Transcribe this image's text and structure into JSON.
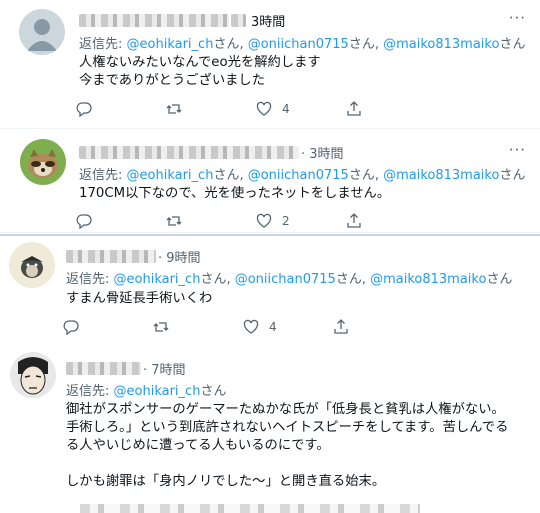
{
  "tweets": [
    {
      "time": "3時間",
      "reply_prefix": "返信先: ",
      "mentions": [
        "@eohikari_ch",
        "@oniichan0715",
        "@maiko813maiko"
      ],
      "san": "さん",
      "sep": ", ",
      "lines": [
        "人権ないみたいなんでeo光を解約します",
        "今までありがとうございました"
      ],
      "counts": {
        "reply": "",
        "retweet": "",
        "like": "4",
        "share": ""
      }
    },
    {
      "time": "· 3時間",
      "reply_prefix": "返信先: ",
      "mentions": [
        "@eohikari_ch",
        "@oniichan0715",
        "@maiko813maiko"
      ],
      "san": "さん",
      "sep": ", ",
      "lines": [
        "170CM以下なので、光を使ったネットをしません。"
      ],
      "counts": {
        "reply": "",
        "retweet": "",
        "like": "2",
        "share": ""
      }
    },
    {
      "time": "· 9時間",
      "reply_prefix": "返信先: ",
      "mentions": [
        "@eohikari_ch",
        "@oniichan0715",
        "@maiko813maiko"
      ],
      "san": "さん",
      "sep": ", ",
      "lines": [
        "すまん骨延長手術いくわ"
      ],
      "counts": {
        "reply": "",
        "retweet": "",
        "like": "4",
        "share": ""
      }
    },
    {
      "time": "· 7時間",
      "reply_prefix": "返信先: ",
      "mentions": [
        "@eohikari_ch"
      ],
      "san": "さん",
      "sep": "",
      "lines": [
        "御社がスポンサーのゲーマーたぬかな氏が「低身長と貧乳は人権がない。",
        "手術しろ。」という到底許されないヘイトスピーチをしてます。苦しんでる",
        "る人やいじめに遭ってる人もいるのにです。",
        "",
        "しかも謝罪は「身内ノリでした〜」と開き直る始末。"
      ]
    }
  ],
  "colors": {
    "accent": "#1d9bf0",
    "muted": "#536471",
    "text": "#0f1419"
  },
  "icons": [
    "more-icon",
    "reply-icon",
    "retweet-icon",
    "like-icon",
    "share-icon"
  ]
}
